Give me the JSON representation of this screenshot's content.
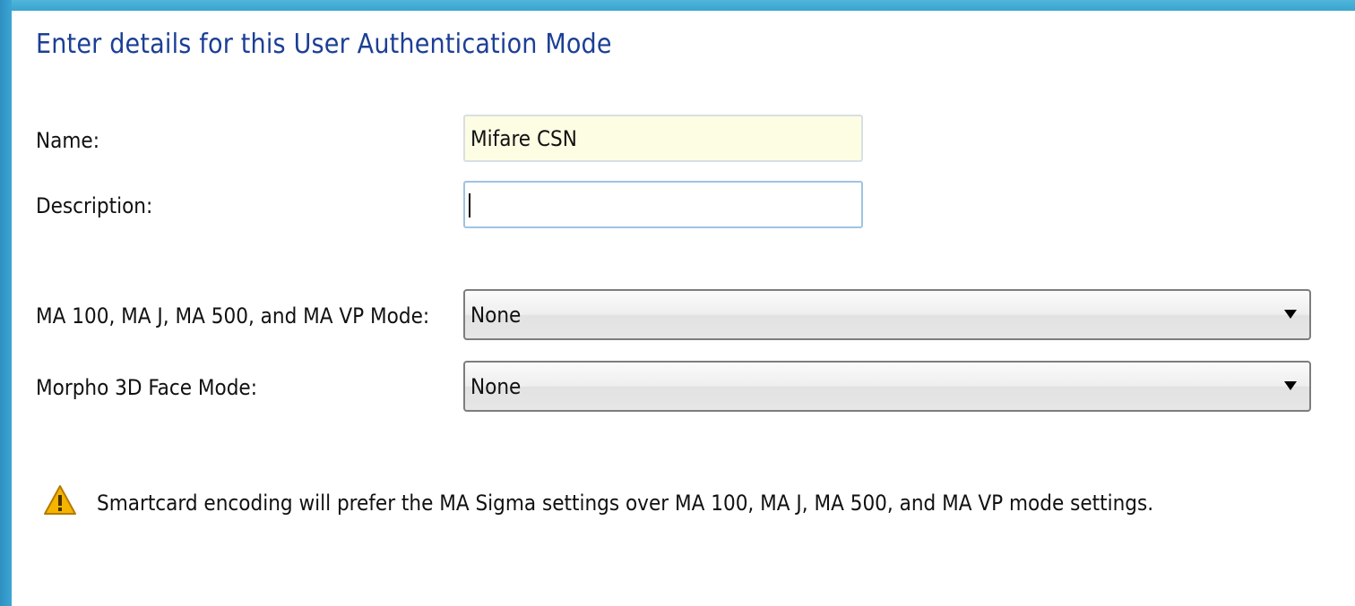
{
  "title": "Enter details for this User Authentication Mode",
  "fields": {
    "name": {
      "label": "Name:",
      "value": "Mifare CSN"
    },
    "description": {
      "label": "Description:",
      "value": ""
    },
    "ma_mode": {
      "label": "MA 100, MA J, MA 500, and MA VP Mode:",
      "selected": "None"
    },
    "face_mode": {
      "label": "Morpho 3D Face Mode:",
      "selected": "None"
    }
  },
  "warning": {
    "icon": "warning-triangle-icon",
    "text": "Smartcard encoding will prefer the MA Sigma settings over MA 100, MA J, MA 500, and MA VP mode settings."
  },
  "colors": {
    "title": "#1c3f95",
    "name_field_bg": "#fdfde3",
    "frame_blue": "#3ba6d3",
    "warning_fill": "#f4b400"
  }
}
